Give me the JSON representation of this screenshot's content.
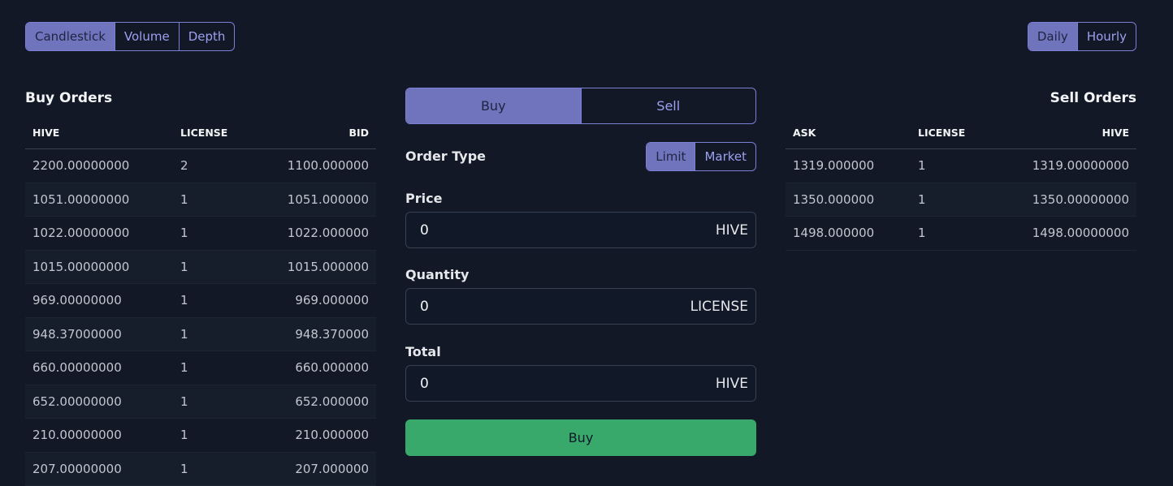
{
  "chart_tabs": [
    {
      "label": "Candlestick",
      "active": true
    },
    {
      "label": "Volume",
      "active": false
    },
    {
      "label": "Depth",
      "active": false
    }
  ],
  "period_tabs": [
    {
      "label": "Daily",
      "active": true
    },
    {
      "label": "Hourly",
      "active": false
    }
  ],
  "buy_orders": {
    "title": "Buy Orders",
    "columns": [
      "HIVE",
      "LICENSE",
      "BID"
    ],
    "rows": [
      [
        "2200.00000000",
        "2",
        "1100.000000"
      ],
      [
        "1051.00000000",
        "1",
        "1051.000000"
      ],
      [
        "1022.00000000",
        "1",
        "1022.000000"
      ],
      [
        "1015.00000000",
        "1",
        "1015.000000"
      ],
      [
        "969.00000000",
        "1",
        "969.000000"
      ],
      [
        "948.37000000",
        "1",
        "948.370000"
      ],
      [
        "660.00000000",
        "1",
        "660.000000"
      ],
      [
        "652.00000000",
        "1",
        "652.000000"
      ],
      [
        "210.00000000",
        "1",
        "210.000000"
      ],
      [
        "207.00000000",
        "1",
        "207.000000"
      ]
    ]
  },
  "sell_orders": {
    "title": "Sell Orders",
    "columns": [
      "ASK",
      "LICENSE",
      "HIVE"
    ],
    "rows": [
      [
        "1319.000000",
        "1",
        "1319.00000000"
      ],
      [
        "1350.000000",
        "1",
        "1350.00000000"
      ],
      [
        "1498.000000",
        "1",
        "1498.00000000"
      ]
    ]
  },
  "order_form": {
    "side_tabs": [
      {
        "label": "Buy",
        "active": true
      },
      {
        "label": "Sell",
        "active": false
      }
    ],
    "order_type_label": "Order Type",
    "order_types": [
      {
        "label": "Limit",
        "active": true
      },
      {
        "label": "Market",
        "active": false
      }
    ],
    "price": {
      "label": "Price",
      "value": "0",
      "unit": "HIVE"
    },
    "quantity": {
      "label": "Quantity",
      "value": "0",
      "unit": "LICENSE"
    },
    "total": {
      "label": "Total",
      "value": "0",
      "unit": "HIVE"
    },
    "submit_label": "Buy"
  },
  "colors": {
    "background": "#121826",
    "accent": "#7074bd",
    "accent_text": "#9ca0f0",
    "buy_button": "#38a96a"
  }
}
